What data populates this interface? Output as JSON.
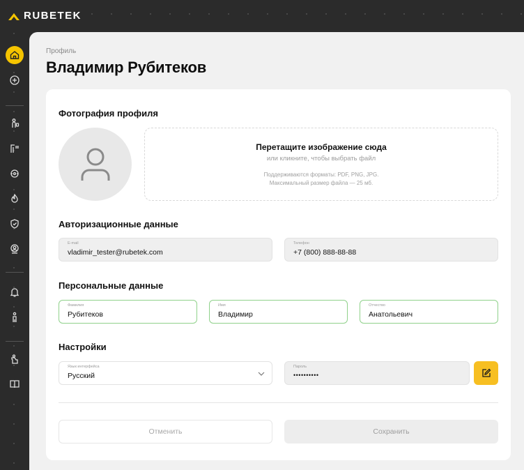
{
  "brand": {
    "name": "RUBETEK",
    "accent_color": "#f5c400"
  },
  "sidebar": {
    "items": [
      {
        "icon": "home-icon",
        "active": true
      },
      {
        "icon": "plus-circle-icon"
      },
      {
        "icon": "person-device-icon"
      },
      {
        "icon": "meter-icon"
      },
      {
        "icon": "camera-icon"
      },
      {
        "icon": "fire-icon"
      },
      {
        "icon": "shield-icon"
      },
      {
        "icon": "user-badge-icon"
      },
      {
        "icon": "bell-icon"
      },
      {
        "icon": "person-icon"
      },
      {
        "icon": "hand-icon"
      },
      {
        "icon": "book-icon"
      }
    ]
  },
  "page": {
    "breadcrumb": "Профиль",
    "title": "Владимир Рубитеков"
  },
  "photo": {
    "section_title": "Фотография профиля",
    "avatar_icon": "user-icon",
    "drop_title": "Перетащите изображение сюда",
    "drop_subtitle": "или кликните, чтобы выбрать файл",
    "drop_note1": "Поддерживаются форматы: PDF, PNG, JPG.",
    "drop_note2": "Максимальный размер файла — 25 мб."
  },
  "auth": {
    "section_title": "Авторизационные данные",
    "email_label": "E-mail",
    "email_value": "vladimir_tester@rubetek.com",
    "phone_label": "Телефон",
    "phone_value": "+7 (800) 888-88-88"
  },
  "personal": {
    "section_title": "Персональные данные",
    "lastname_label": "Фамилия",
    "lastname_value": "Рубитеков",
    "firstname_label": "Имя",
    "firstname_value": "Владимир",
    "middlename_label": "Отчество",
    "middlename_value": "Анатольевич"
  },
  "settings": {
    "section_title": "Настройки",
    "language_label": "Язык интерфейса",
    "language_value": "Русский",
    "password_label": "Пароль",
    "password_value": "••••••••••"
  },
  "actions": {
    "cancel_label": "Отменить",
    "save_label": "Сохранить"
  }
}
